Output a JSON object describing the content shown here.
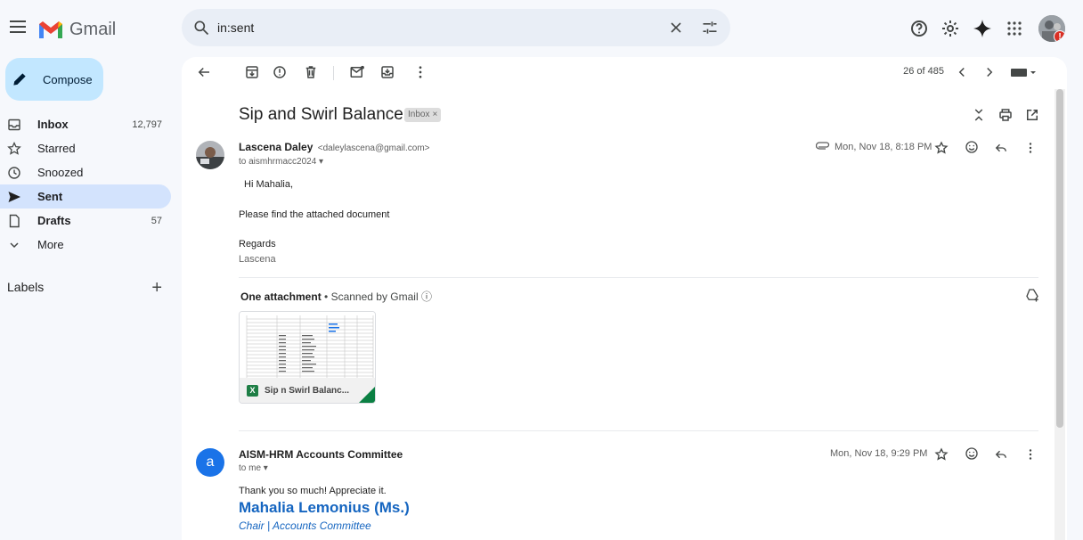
{
  "app": {
    "name": "Gmail"
  },
  "search": {
    "value": "in:sent"
  },
  "sidebar": {
    "compose": "Compose",
    "items": [
      {
        "label": "Inbox",
        "count": "12,797",
        "icon": "inbox-icon"
      },
      {
        "label": "Starred",
        "count": "",
        "icon": "star-icon"
      },
      {
        "label": "Snoozed",
        "count": "",
        "icon": "clock-icon"
      },
      {
        "label": "Sent",
        "count": "",
        "icon": "send-icon"
      },
      {
        "label": "Drafts",
        "count": "57",
        "icon": "draft-icon"
      },
      {
        "label": "More",
        "count": "",
        "icon": "chevron-down-icon"
      }
    ],
    "labels_title": "Labels"
  },
  "toolbar": {
    "pager": "26 of 485"
  },
  "thread": {
    "subject": "Sip and Swirl Balance",
    "label_chip": "Inbox",
    "messages": [
      {
        "sender_name": "Lascena Daley",
        "sender_email": "<daleylascena@gmail.com>",
        "to": "to aismhrmacc2024",
        "date": "Mon, Nov 18, 8:18 PM",
        "body": [
          "Hi Mahalia,",
          "Please find the attached document",
          "Regards",
          "Lascena"
        ],
        "attachment_title": "One attachment",
        "attachment_scanned": "Scanned by Gmail",
        "attachment_name": "Sip n Swirl Balanc..."
      },
      {
        "avatar_letter": "a",
        "sender_name": "AISM-HRM Accounts Committee",
        "to": "to me",
        "date": "Mon, Nov 18, 9:29 PM",
        "body": "Thank you so much! Appreciate it.",
        "sig_name": "Mahalia Lemonius (Ms.)",
        "sig_title": "Chair | Accounts Committee"
      }
    ]
  },
  "colors": {
    "accent": "#0b57d0",
    "compose_bg": "#c2e7ff",
    "active_nav": "#d3e3fd",
    "avatar_a": "#1a73e8",
    "link_blue": "#1565c0"
  }
}
